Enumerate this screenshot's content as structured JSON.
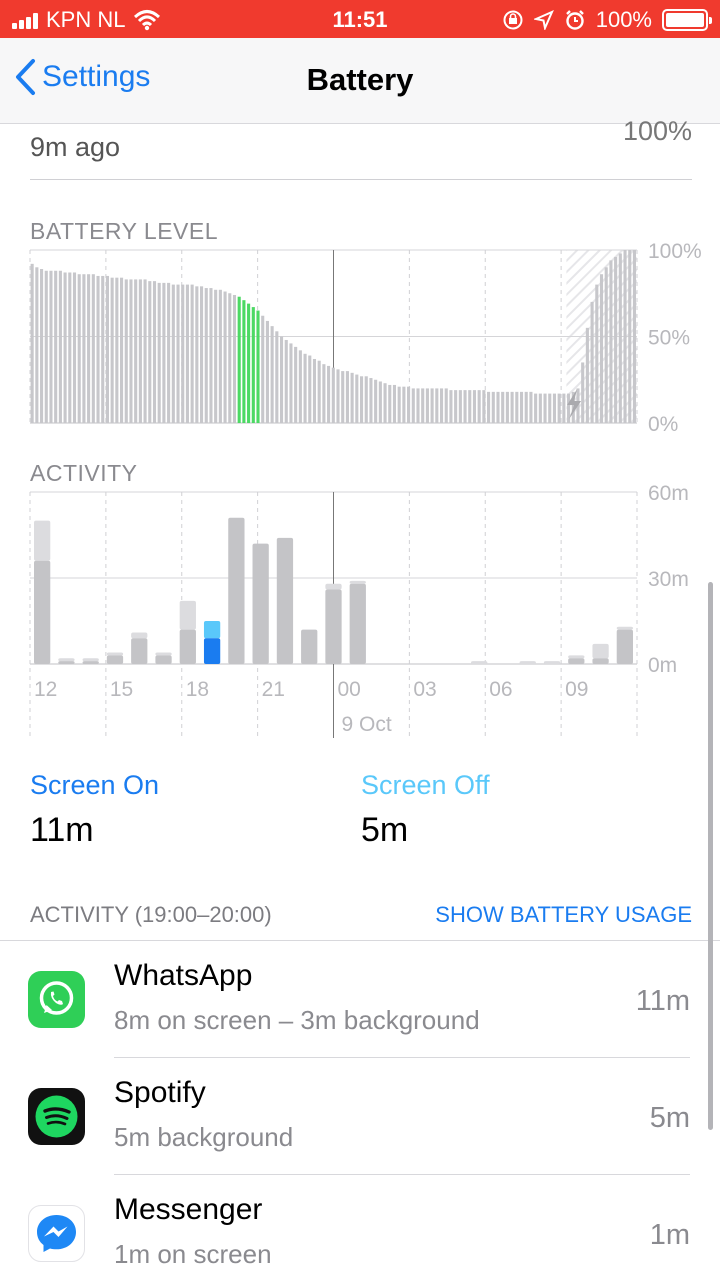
{
  "status": {
    "carrier": "KPN NL",
    "time": "11:51",
    "battery": "100%"
  },
  "nav": {
    "back_label": "Settings",
    "title": "Battery"
  },
  "last_charge": {
    "ago": "9m ago",
    "level": "100%"
  },
  "battery_level": {
    "label": "BATTERY LEVEL",
    "y_ticks": [
      "100%",
      "50%",
      "0%"
    ],
    "levels": [
      92,
      90,
      89,
      88,
      88,
      88,
      88,
      87,
      87,
      87,
      86,
      86,
      86,
      86,
      85,
      85,
      85,
      84,
      84,
      84,
      83,
      83,
      83,
      83,
      83,
      82,
      82,
      81,
      81,
      81,
      80,
      80,
      80,
      80,
      80,
      79,
      79,
      78,
      78,
      77,
      77,
      76,
      75,
      74,
      73,
      71,
      69,
      67,
      65,
      62,
      59,
      56,
      53,
      50,
      48,
      46,
      44,
      42,
      40,
      39,
      37,
      36,
      34,
      33,
      32,
      31,
      30,
      30,
      29,
      28,
      27,
      27,
      26,
      25,
      24,
      23,
      22,
      22,
      21,
      21,
      21,
      20,
      20,
      20,
      20,
      20,
      20,
      20,
      20,
      19,
      19,
      19,
      19,
      19,
      19,
      19,
      19,
      18,
      18,
      18,
      18,
      18,
      18,
      18,
      18,
      18,
      18,
      17,
      17,
      17,
      17,
      17,
      17,
      17,
      17,
      18,
      20,
      35,
      55,
      70,
      80,
      86,
      90,
      94,
      96,
      98,
      100,
      100,
      100
    ],
    "charging_label": "charging",
    "green_range": [
      44,
      48
    ]
  },
  "activity": {
    "label": "ACTIVITY",
    "y_ticks": [
      "60m",
      "30m",
      "0m"
    ],
    "x_ticks": [
      "12",
      "15",
      "18",
      "21",
      "00",
      "03",
      "06",
      "09"
    ],
    "date_label": "9 Oct",
    "screen_on": [
      36,
      1,
      1,
      3,
      9,
      3,
      12,
      9,
      51,
      42,
      44,
      12,
      26,
      28,
      0,
      0,
      0,
      0,
      0,
      0,
      0,
      0,
      2,
      2,
      12
    ],
    "screen_off": [
      14,
      1,
      1,
      1,
      2,
      1,
      10,
      6,
      0,
      0,
      0,
      0,
      2,
      1,
      0,
      0,
      0,
      0,
      1,
      0,
      1,
      1,
      1,
      5,
      1
    ],
    "highlight_index": 7
  },
  "screen_on": {
    "label": "Screen On",
    "value": "11m"
  },
  "screen_off": {
    "label": "Screen Off",
    "value": "5m"
  },
  "activity_header": {
    "range": "ACTIVITY (19:00–20:00)",
    "link": "SHOW BATTERY USAGE"
  },
  "apps": [
    {
      "name": "WhatsApp",
      "detail": "8m on screen – 3m background",
      "time": "11m",
      "icon": "whatsapp-icon"
    },
    {
      "name": "Spotify",
      "detail": "5m background",
      "time": "5m",
      "icon": "spotify-icon"
    },
    {
      "name": "Messenger",
      "detail": "1m on screen",
      "time": "1m",
      "icon": "messenger-icon"
    }
  ],
  "colors": {
    "accent": "#1a7cf0",
    "screen_off": "#5ac8fa",
    "status_bar": "#f03a2e",
    "green": "#4cd964"
  }
}
